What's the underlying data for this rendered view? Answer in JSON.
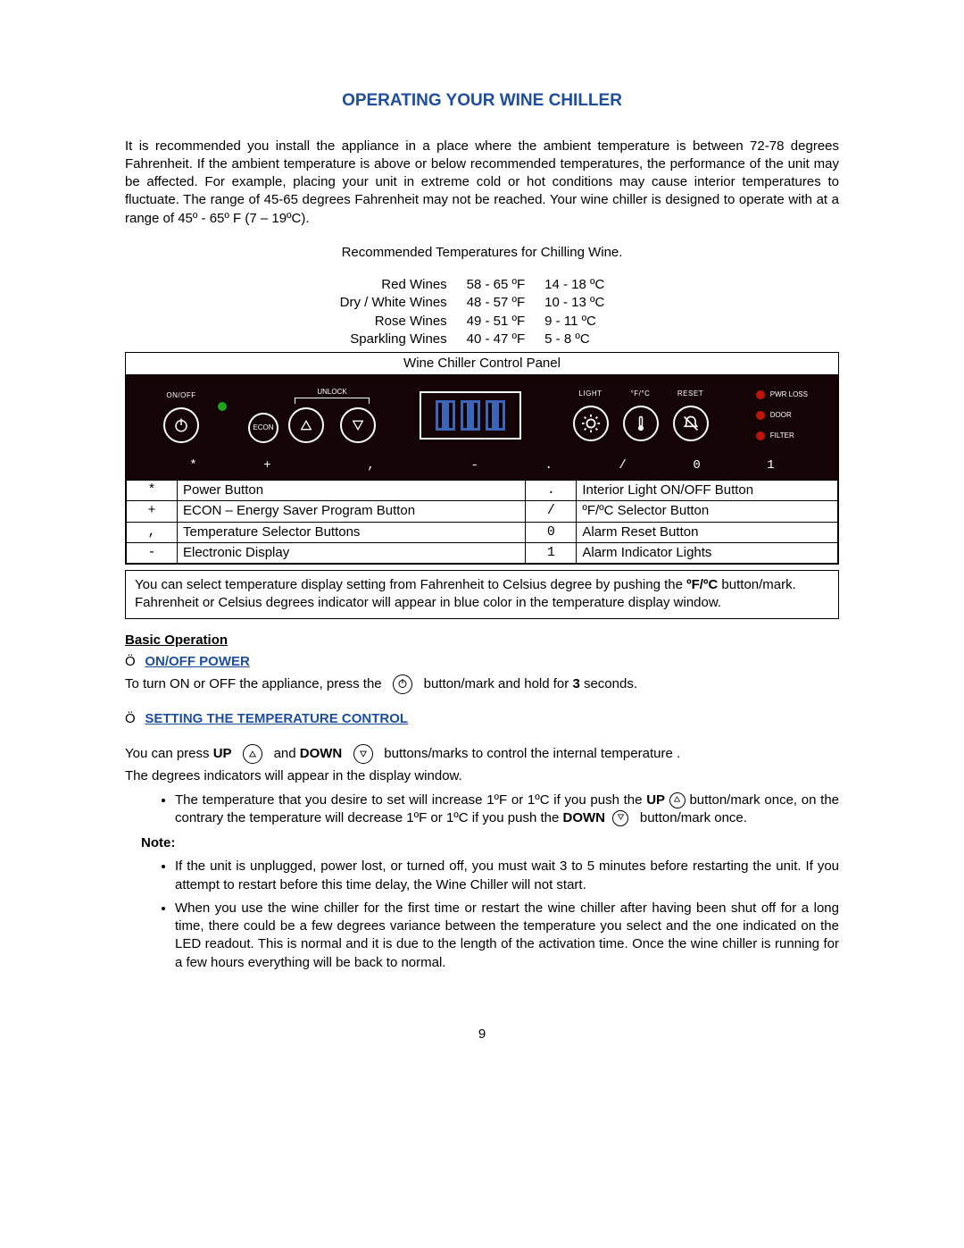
{
  "title": "OPERATING YOUR WINE CHILLER",
  "intro": "It is recommended you install the appliance in a place where the ambient temperature is between 72-78 degrees Fahrenheit.  If the ambient temperature is above or below recommended temperatures, the performance of the unit may be affected.  For example, placing your unit in extreme cold or hot conditions may cause interior temperatures to fluctuate.  The range of 45-65 degrees Fahrenheit may not be reached.  Your wine chiller is designed to operate with at a range of 45º - 65º F (7 – 19ºC).",
  "temps_caption": "Recommended Temperatures for Chilling Wine.",
  "temps_table": [
    {
      "name": "Red Wines",
      "f": "58 - 65 ºF",
      "c": "14 - 18 ºC"
    },
    {
      "name": "Dry / White Wines",
      "f": "48 - 57 ºF",
      "c": "10 - 13 ºC"
    },
    {
      "name": "Rose Wines",
      "f": "49 - 51 ºF",
      "c": "9 - 11 ºC"
    },
    {
      "name": "Sparkling Wines",
      "f": "40 - 47 ºF",
      "c": "5 - 8 ºC"
    }
  ],
  "panel_caption": "Wine Chiller  Control Panel",
  "panel_labels": {
    "onoff": "ON/OFF",
    "econ": "ECON",
    "unlock": "UNLOCK",
    "light": "LIGHT",
    "fc": "°F/°C",
    "reset": "RESET",
    "pwr": "PWR  LOSS",
    "door": "DOOR",
    "filter": "FILTER"
  },
  "markers": [
    "*",
    "+",
    ",",
    "-",
    ".",
    "/",
    "0",
    "1"
  ],
  "legend": [
    {
      "s": "*",
      "d": "Power Button"
    },
    {
      "s": "+",
      "d": "ECON – Energy Saver Program Button"
    },
    {
      "s": ",",
      "d": "Temperature Selector Buttons"
    },
    {
      "s": "-",
      "d": "Electronic Display"
    },
    {
      "s": ".",
      "d": "Interior Light ON/OFF Button"
    },
    {
      "s": "/",
      "d": "ºF/ºC Selector Button"
    },
    {
      "s": "0",
      "d": "Alarm Reset Button"
    },
    {
      "s": "1",
      "d": "Alarm Indicator Lights"
    }
  ],
  "fc_note_a": "You can select temperature display setting from Fahrenheit to Celsius degree by pushing the ",
  "fc_note_b": "ºF/ºC",
  "fc_note_c": " button/mark. Fahrenheit or Celsius degrees indicator will appear in blue color in the temperature display window.",
  "basic_op": "Basic Operation",
  "onoff_head": "ON/OFF POWER",
  "onoff_a": "To turn ON or OFF the appliance, press the",
  "onoff_b": "button/mark and hold for ",
  "onoff_c": "3",
  "onoff_d": " seconds.",
  "settemp_head": "SETTING THE TEMPERATURE CONTROL",
  "settemp_a": "You can press ",
  "settemp_b": "UP",
  "settemp_c": "and ",
  "settemp_d": "DOWN",
  "settemp_e": "buttons/marks to control the internal temperature .",
  "settemp_line2": "The degrees indicators will appear in the display window.",
  "bullet1_a": "The temperature that you desire to set will increase 1ºF or 1ºC if you push the ",
  "bullet1_b": "UP",
  "bullet1_c": " button/mark once, on the contrary the temperature will decrease 1ºF or 1ºC if you push the ",
  "bullet1_d": "DOWN",
  "bullet1_e": "button/mark once.",
  "note_head": "Note:",
  "note_bullets": [
    "If the unit is unplugged, power lost, or turned off, you must wait 3 to 5 minutes before restarting the unit. If you attempt to restart before this time delay, the Wine Chiller will not start.",
    "When you use the wine chiller for the first time or restart the wine chiller after having been shut off for a long time, there could be a few degrees variance between the temperature you select and the one indicated on the LED readout.  This is normal and it is due to the length of the activation time. Once the wine chiller is running for a few hours everything will be back to normal."
  ],
  "page_number": "9"
}
